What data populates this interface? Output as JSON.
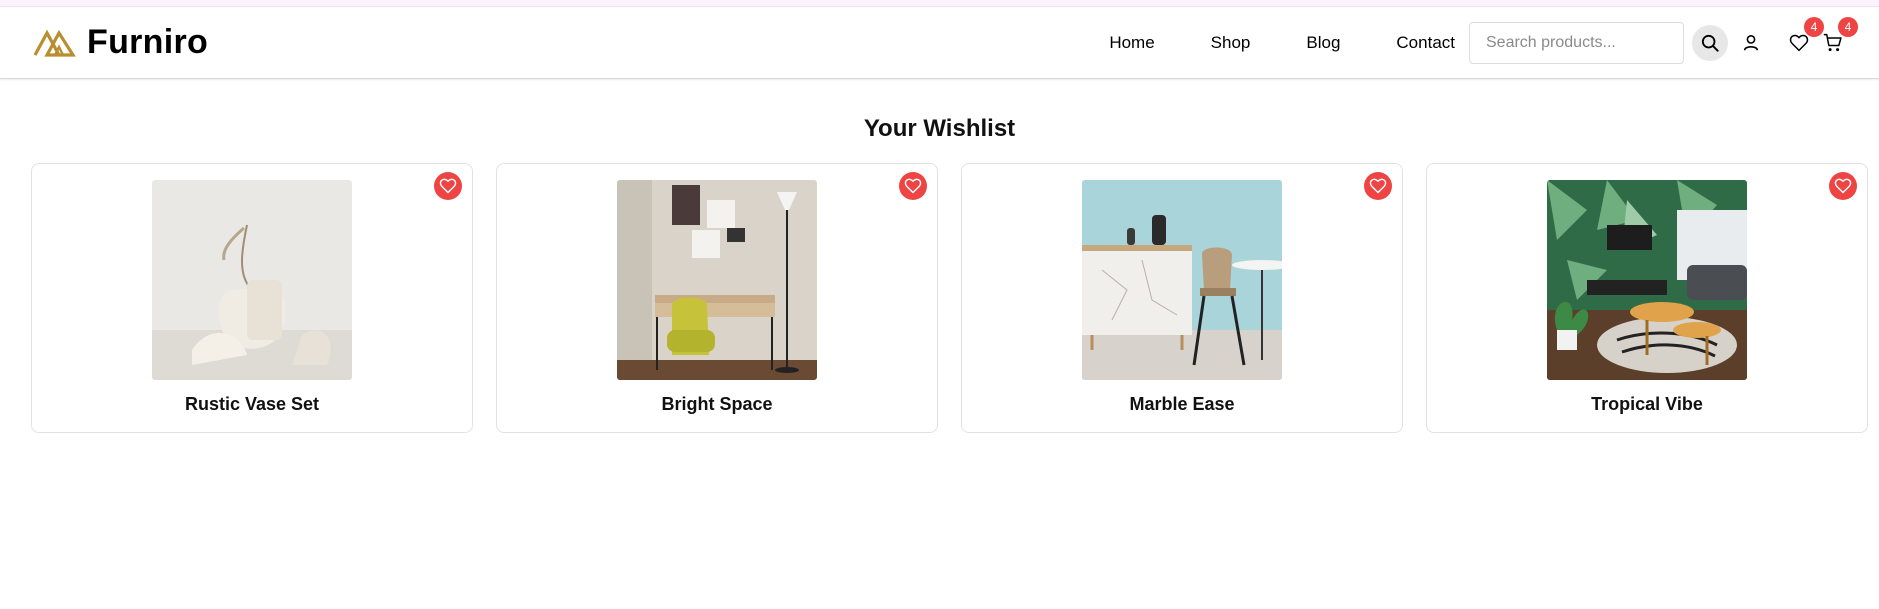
{
  "header": {
    "brand": "Furniro",
    "brand_color": "#b88e2f",
    "nav": [
      {
        "label": "Home"
      },
      {
        "label": "Shop"
      },
      {
        "label": "Blog"
      },
      {
        "label": "Contact"
      }
    ],
    "search": {
      "placeholder": "Search products...",
      "value": "",
      "icon": "search-icon"
    },
    "account_icon": "user-icon",
    "wishlist": {
      "icon": "heart-icon",
      "count": "4"
    },
    "cart": {
      "icon": "cart-icon",
      "count": "4"
    }
  },
  "main": {
    "title": "Your Wishlist",
    "items": [
      {
        "name": "Rustic Vase Set"
      },
      {
        "name": "Bright Space"
      },
      {
        "name": "Marble Ease"
      },
      {
        "name": "Tropical Vibe"
      }
    ]
  },
  "colors": {
    "accent_red": "#ef4444",
    "text": "#111111",
    "border": "#e2e2e2"
  }
}
